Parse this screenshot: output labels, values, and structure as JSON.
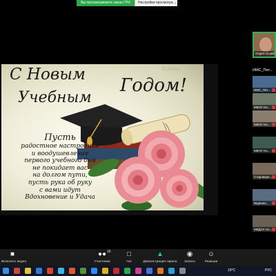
{
  "share_bar": {
    "status": "Вы просматриваете экран ГРИ",
    "settings": "Настройки просмотра ⌄"
  },
  "card": {
    "title_line1": "С Новым",
    "title_line2": "Учебным",
    "title_line3": "Годом!",
    "watermark": "©Alona",
    "verse_first": "Пусть",
    "verse_lines": [
      "радостное настроение",
      "и воодушевление",
      "первого учебного дня",
      "не покидает вас",
      "на долгом пути,",
      "пусть рука об руку",
      "с вами идут",
      "Вдохновение и Удача"
    ]
  },
  "sidebar": {
    "self_label": "Отдел по раб...",
    "header": "ИМС_Пет...",
    "participants": [
      {
        "label": "ИМС_Пет...",
        "bg": "#4a6b8f"
      },
      {
        "label": "МКОУ Но...",
        "bg": "#6d7a6a"
      },
      {
        "label": "МКОУ Но...",
        "bg": "#8a7d6e"
      },
      {
        "label": "МКОУ Но...",
        "bg": "#3f5a4f"
      },
      {
        "label": "Староверн...",
        "bg": "#7a6a5a"
      },
      {
        "label": "Веденко...",
        "bg": "#5a6d80"
      },
      {
        "label": "МКДОУ Но...",
        "bg": "#6a5f55"
      }
    ]
  },
  "toolbar": {
    "video_label": "Включить видео",
    "participants_label": "Участники",
    "participants_count": "26",
    "chat_label": "Чат",
    "share_label": "Демонстрация экрана",
    "record_label": "Запись",
    "reactions_label": "Реакции"
  },
  "taskbar": {
    "weather": "19°C",
    "lang": "РУС"
  },
  "colors": {
    "share_green": "#2ea84a",
    "active_speaker_border": "#35b34a",
    "toolbar_bg": "#1a1a1a",
    "taskbar_bg": "#101828"
  }
}
